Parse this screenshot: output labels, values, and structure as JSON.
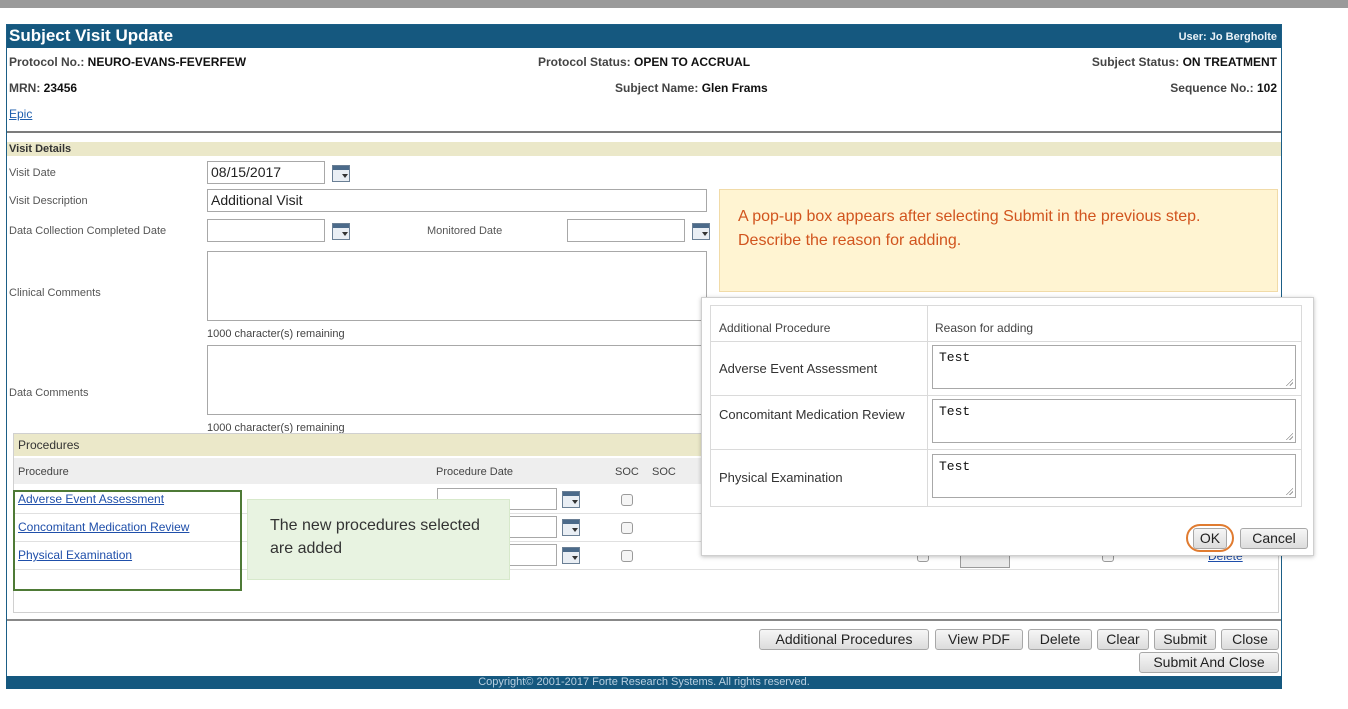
{
  "header": {
    "title": "Subject Visit Update",
    "user": "User: Jo Bergholte",
    "protocol_no_label": "Protocol No.:",
    "protocol_no": "NEURO-EVANS-FEVERFEW",
    "protocol_status_label": "Protocol Status:",
    "protocol_status": "OPEN TO ACCRUAL",
    "subject_status_label": "Subject Status:",
    "subject_status": "ON TREATMENT",
    "mrn_label": "MRN:",
    "mrn": "23456",
    "subject_name_label": "Subject Name:",
    "subject_name": "Glen Frams",
    "sequence_label": "Sequence No.:",
    "sequence": "102",
    "epic_link": "Epic"
  },
  "visit_details": {
    "section_title": "Visit Details",
    "visit_date_label": "Visit Date",
    "visit_date": "08/15/2017",
    "visit_description_label": "Visit Description",
    "visit_description": "Additional Visit",
    "data_collection_label": "Data Collection Completed Date",
    "data_collection_value": "",
    "monitored_date_label": "Monitored Date",
    "monitored_date_value": "",
    "clinical_comments_label": "Clinical Comments",
    "clinical_remaining": "1000 character(s) remaining",
    "data_comments_label": "Data Comments",
    "data_remaining": "1000 character(s) remaining"
  },
  "procedures": {
    "section_title": "Procedures",
    "columns": {
      "procedure": "Procedure",
      "procedure_date": "Procedure Date",
      "soc": "SOC",
      "soc2": "SOC"
    },
    "rows": [
      {
        "name": "Adverse Event Assessment"
      },
      {
        "name": "Concomitant Medication Review"
      },
      {
        "name": "Physical Examination",
        "delete": "Delete"
      }
    ]
  },
  "buttons": {
    "additional_procedures": "Additional Procedures",
    "view_pdf": "View PDF",
    "delete": "Delete",
    "clear": "Clear",
    "submit": "Submit",
    "close": "Close",
    "submit_and_close": "Submit And Close"
  },
  "copyright": "Copyright© 2001-2017 Forte Research Systems. All rights reserved.",
  "callouts": {
    "popup_note": "A pop-up box appears after selecting Submit in the previous step. Describe the reason for adding.",
    "added_note": "The new procedures selected are added"
  },
  "popup": {
    "col_procedure": "Additional Procedure",
    "col_reason": "Reason for adding",
    "rows": [
      {
        "procedure": "Adverse Event Assessment",
        "reason": "Test"
      },
      {
        "procedure": "Concomitant Medication Review",
        "reason": "Test"
      },
      {
        "procedure": "Physical Examination",
        "reason": "Test"
      }
    ],
    "ok": "OK",
    "cancel": "Cancel"
  },
  "colors": {
    "title_bar": "#15587f",
    "section_bar": "#ebe8c9",
    "link": "#1f4faa",
    "callout_orange_text": "#d1541e",
    "highlight_green": "#4e7a36",
    "ok_ring": "#e07b30"
  }
}
